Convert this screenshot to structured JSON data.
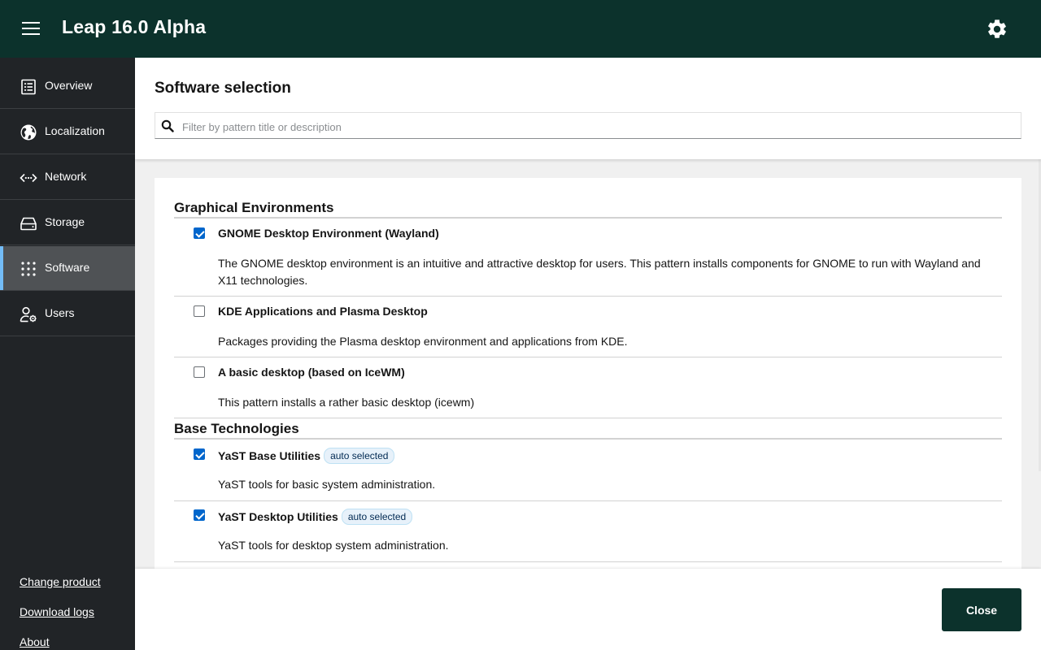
{
  "app": {
    "title": "Leap 16.0 Alpha"
  },
  "sidebar": {
    "items": [
      {
        "label": "Overview",
        "icon": "list-icon"
      },
      {
        "label": "Localization",
        "icon": "globe-icon"
      },
      {
        "label": "Network",
        "icon": "network-icon"
      },
      {
        "label": "Storage",
        "icon": "drive-icon"
      },
      {
        "label": "Software",
        "icon": "apps-grid-icon",
        "active": true
      },
      {
        "label": "Users",
        "icon": "user-settings-icon"
      }
    ],
    "links": {
      "change_product": "Change product",
      "download_logs": "Download logs",
      "about": "About"
    }
  },
  "page": {
    "title": "Software selection",
    "search_placeholder": "Filter by pattern title or description"
  },
  "groups": [
    {
      "title": "Graphical Environments",
      "patterns": [
        {
          "title": "GNOME Desktop Environment (Wayland)",
          "checked": true,
          "desc": "The GNOME desktop environment is an intuitive and attractive desktop for users. This pattern installs components for GNOME to run with Wayland and X11 technologies."
        },
        {
          "title": "KDE Applications and Plasma Desktop",
          "checked": false,
          "desc": "Packages providing the Plasma desktop environment and applications from KDE."
        },
        {
          "title": "A basic desktop (based on IceWM)",
          "checked": false,
          "desc": "This pattern installs a rather basic desktop (icewm)"
        }
      ]
    },
    {
      "title": "Base Technologies",
      "patterns": [
        {
          "title": "YaST Base Utilities",
          "checked": true,
          "badge": "auto selected",
          "desc": "YaST tools for basic system administration."
        },
        {
          "title": "YaST Desktop Utilities",
          "checked": true,
          "badge": "auto selected",
          "desc": "YaST tools for desktop system administration."
        }
      ]
    }
  ],
  "footer": {
    "close_label": "Close"
  },
  "colors": {
    "brand_dark": "#0c322c",
    "sidebar_bg": "#212427",
    "active_accent": "#73bcf7",
    "checkbox_blue": "#0066cc"
  }
}
